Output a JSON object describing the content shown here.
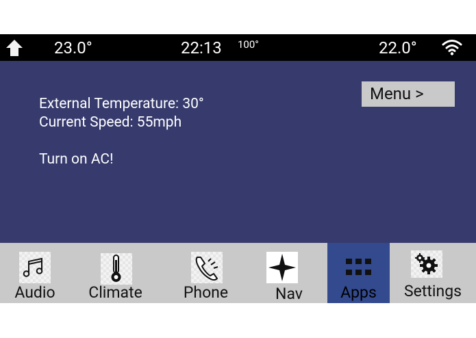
{
  "status": {
    "left_temp": "23.0°",
    "time": "22:13",
    "outside_temp": "100°",
    "right_temp": "22.0°",
    "icons": [
      "home-icon",
      "wifi-icon"
    ]
  },
  "main": {
    "ext_temp_label": "External Temperature: 30°",
    "speed_label": "Current Speed: 55mph",
    "alert": "Turn on AC!",
    "menu_button": "Menu >"
  },
  "nav": {
    "items": [
      {
        "label": "Audio",
        "icon": "music-notes-icon"
      },
      {
        "label": "Climate",
        "icon": "thermometer-icon"
      },
      {
        "label": "Phone",
        "icon": "phone-icon"
      },
      {
        "label": "Nav",
        "icon": "compass-star-icon"
      },
      {
        "label": "Apps",
        "icon": "grid-icon",
        "active": true
      },
      {
        "label": "Settings",
        "icon": "gear-icon"
      }
    ]
  },
  "colors": {
    "statusbar": "#000000",
    "main_bg": "#363a6d",
    "navbar": "#c9c9c9",
    "active_tab": "#334a8f",
    "menu_button": "#c9c9c9"
  }
}
